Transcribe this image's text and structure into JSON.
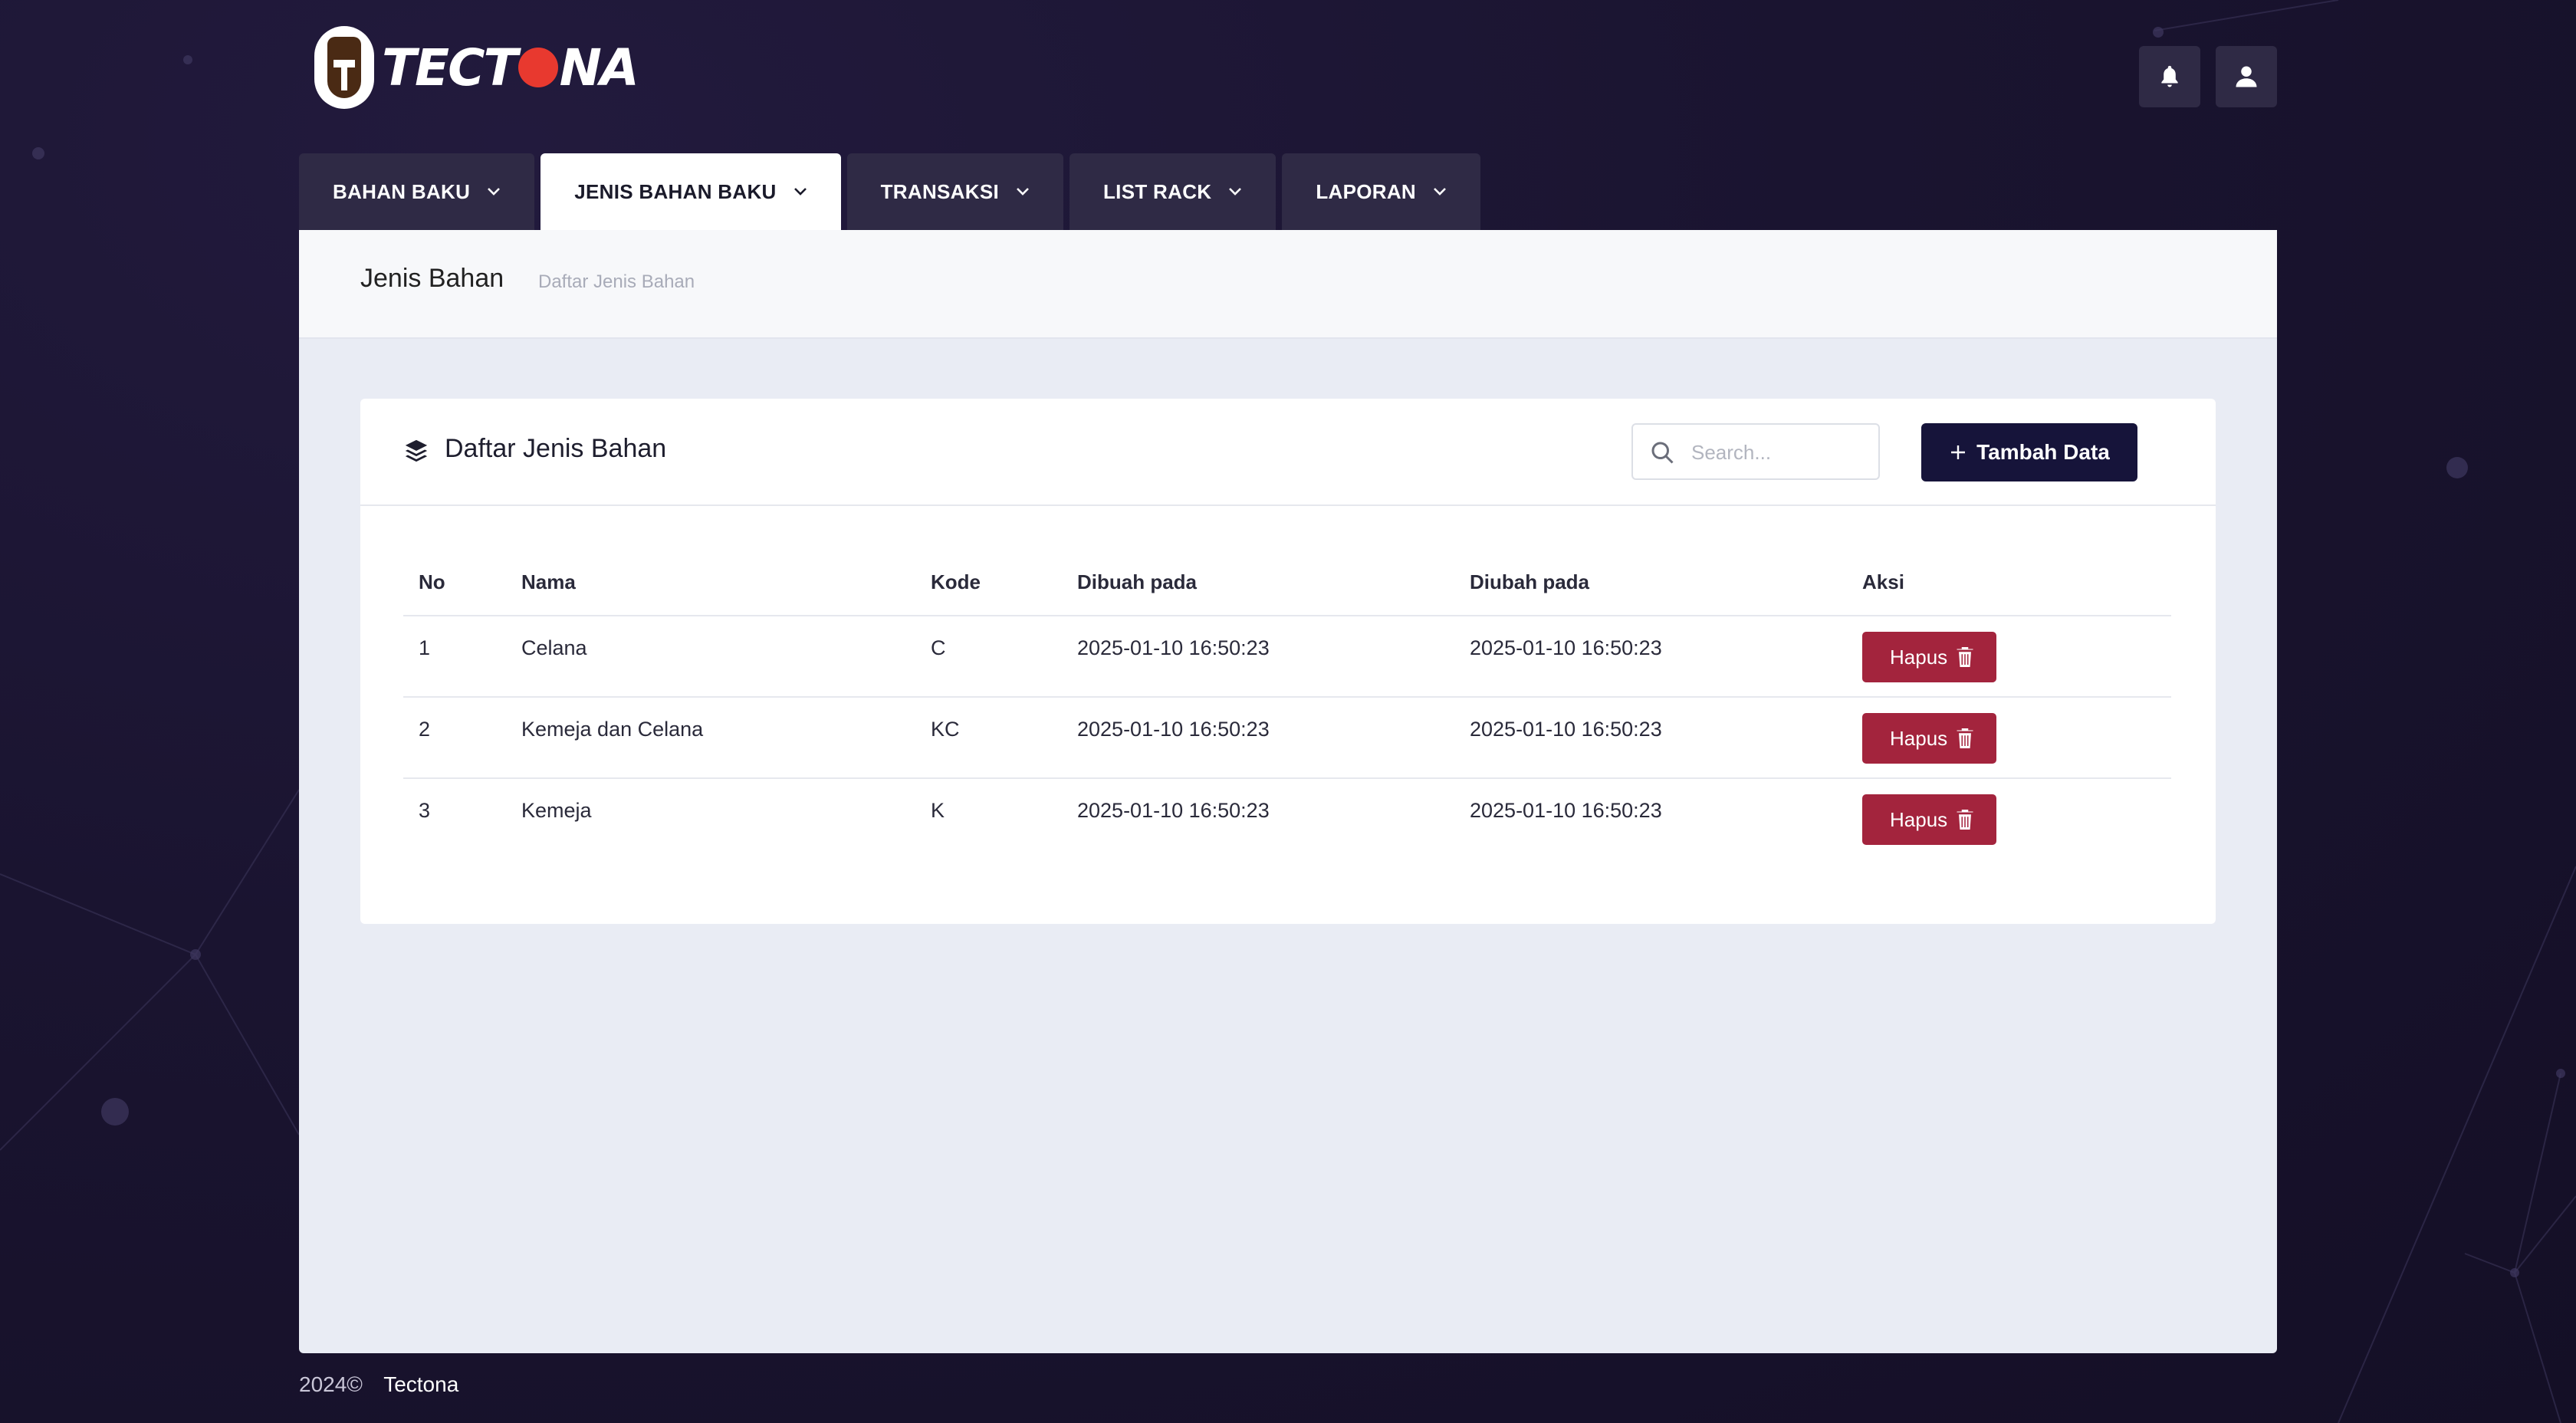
{
  "brand": {
    "name": "TECTONA"
  },
  "header": {
    "notification_icon": "bell-icon",
    "user_icon": "user-icon"
  },
  "tabs": [
    {
      "label": "BAHAN BAKU",
      "active": false
    },
    {
      "label": "JENIS BAHAN BAKU",
      "active": true
    },
    {
      "label": "TRANSAKSI",
      "active": false
    },
    {
      "label": "LIST RACK",
      "active": false
    },
    {
      "label": "LAPORAN",
      "active": false
    }
  ],
  "breadcrumb": {
    "title": "Jenis Bahan",
    "subtitle": "Daftar Jenis Bahan"
  },
  "card": {
    "title": "Daftar Jenis Bahan",
    "icon": "layers-icon",
    "search_placeholder": "Search...",
    "add_button": "Tambah Data"
  },
  "table": {
    "columns": [
      "No",
      "Nama",
      "Kode",
      "Dibuah pada",
      "Diubah pada",
      "Aksi"
    ],
    "rows": [
      {
        "no": "1",
        "nama": "Celana",
        "kode": "C",
        "dibuat": "2025-01-10 16:50:23",
        "diubah": "2025-01-10 16:50:23",
        "aksi": "Hapus"
      },
      {
        "no": "2",
        "nama": "Kemeja dan Celana",
        "kode": "KC",
        "dibuat": "2025-01-10 16:50:23",
        "diubah": "2025-01-10 16:50:23",
        "aksi": "Hapus"
      },
      {
        "no": "3",
        "nama": "Kemeja",
        "kode": "K",
        "dibuat": "2025-01-10 16:50:23",
        "diubah": "2025-01-10 16:50:23",
        "aksi": "Hapus"
      }
    ]
  },
  "footer": {
    "year": "2024©",
    "name": "Tectona"
  },
  "colors": {
    "accent": "#16143a",
    "danger": "#a3243d",
    "background": "#1a1430"
  }
}
